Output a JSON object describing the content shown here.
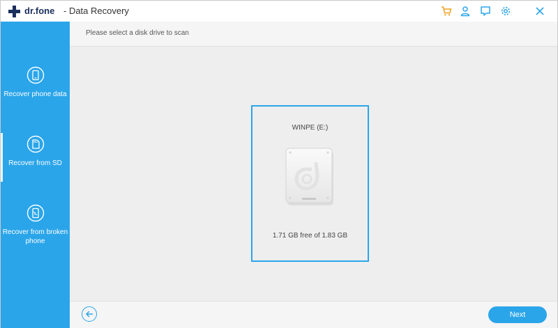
{
  "window": {
    "brand": "dr.fone",
    "title": "- Data Recovery"
  },
  "toolbar": {
    "icons": [
      "cart-icon",
      "account-icon",
      "feedback-icon",
      "settings-icon",
      "close-icon"
    ]
  },
  "sidebar": {
    "items": [
      {
        "label": "Recover phone data",
        "icon": "phone-recover-icon"
      },
      {
        "label": "Recover from SD",
        "icon": "sd-card-recover-icon"
      },
      {
        "label": "Recover from broken phone",
        "icon": "broken-phone-recover-icon"
      }
    ]
  },
  "main": {
    "prompt": "Please select a disk drive to scan",
    "drive": {
      "name": "WINPE (E:)",
      "free_text": "1.71 GB free of 1.83 GB",
      "icon": "hard-drive-icon"
    }
  },
  "footer": {
    "back_icon": "back-arrow-icon",
    "next_label": "Next"
  },
  "colors": {
    "accent": "#2aa5ea",
    "brand": "#1b2f5c",
    "toolbar_icon": "#2aa5ea",
    "cart_icon": "#f0a020"
  }
}
